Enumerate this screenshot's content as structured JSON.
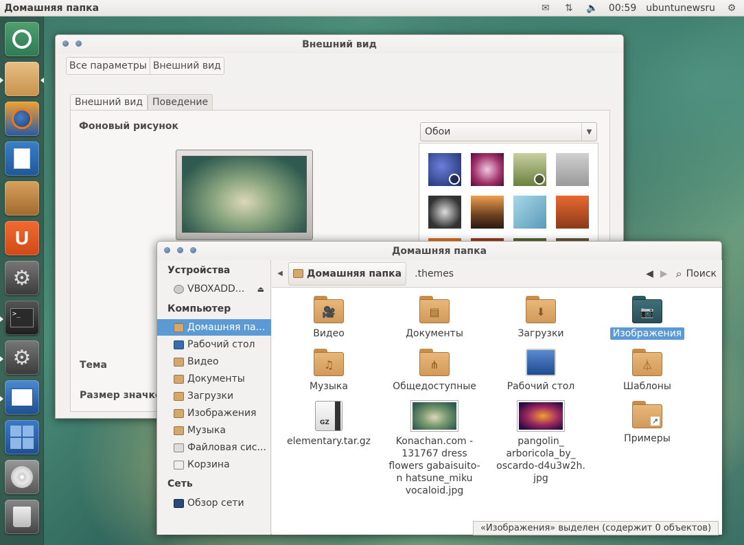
{
  "top_panel": {
    "title": "Домашняя папка",
    "time": "00:59",
    "user": "ubuntunewsru"
  },
  "appearance": {
    "title": "Внешний вид",
    "breadcrumbs": [
      "Все параметры",
      "Внешний вид"
    ],
    "tabs": [
      "Внешний вид",
      "Поведение"
    ],
    "background_label": "Фоновый рисунок",
    "theme_label": "Тема",
    "icon_size_label": "Размер значков",
    "wallpaper_select": "Обои"
  },
  "nautilus": {
    "title": "Домашняя папка",
    "sidebar": {
      "devices_header": "Устройства",
      "devices": [
        "VBOXADD..."
      ],
      "computer_header": "Компьютер",
      "computer": [
        "Домашняя па...",
        "Рабочий стол",
        "Видео",
        "Документы",
        "Загрузки",
        "Изображения",
        "Музыка",
        "Файловая сис...",
        "Корзина"
      ],
      "network_header": "Сеть",
      "network": [
        "Обзор сети"
      ]
    },
    "path": {
      "current": "Домашняя папка",
      "next": ".themes"
    },
    "search_label": "Поиск",
    "files": [
      "Видео",
      "Документы",
      "Загрузки",
      "Изображения",
      "Музыка",
      "Общедоступные",
      "Рабочий стол",
      "Шаблоны",
      "elementary.tar.gz",
      "Konachan.com - 131767 dress flowers gabaisuito-n hatsune_miku vocaloid.jpg",
      "pangolin_ arboricola_by_ oscardo-d4u3w2h. jpg",
      "Примеры"
    ],
    "status": "«Изображения» выделен (содержит 0 объектов)"
  }
}
